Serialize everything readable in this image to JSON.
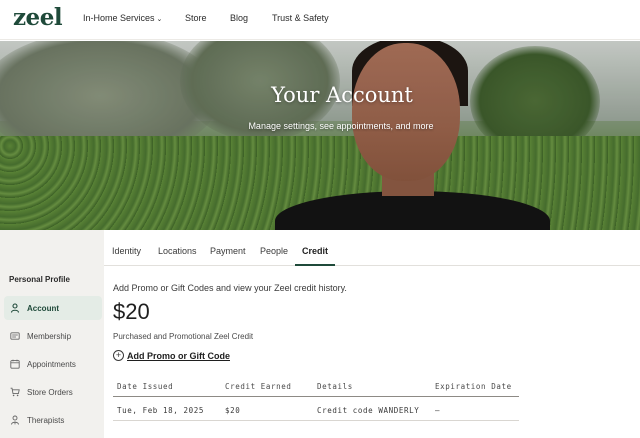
{
  "brand": {
    "logo_text": "zeel",
    "accent": "#1f4a3a"
  },
  "nav": {
    "items": [
      {
        "label": "In-Home Services",
        "has_dropdown": true
      },
      {
        "label": "Store"
      },
      {
        "label": "Blog"
      },
      {
        "label": "Trust & Safety"
      }
    ]
  },
  "hero": {
    "title": "Your Account",
    "subtitle": "Manage settings, see appointments, and more"
  },
  "tabs": {
    "items": [
      {
        "label": "Identity"
      },
      {
        "label": "Locations"
      },
      {
        "label": "Payment"
      },
      {
        "label": "People"
      },
      {
        "label": "Credit",
        "active": true
      }
    ]
  },
  "sidebar": {
    "heading": "Personal Profile",
    "items": [
      {
        "label": "Account",
        "icon": "user-icon",
        "active": true
      },
      {
        "label": "Membership",
        "icon": "membership-card-icon"
      },
      {
        "label": "Appointments",
        "icon": "calendar-icon"
      },
      {
        "label": "Store Orders",
        "icon": "shopping-cart-icon"
      },
      {
        "label": "Therapists",
        "icon": "therapist-icon"
      }
    ]
  },
  "credit": {
    "intro": "Add Promo or Gift Codes and view your Zeel credit history.",
    "balance": "$20",
    "balance_caption": "Purchased and Promotional Zeel Credit",
    "add_code_label": "Add Promo or Gift Code",
    "table": {
      "columns": [
        "Date Issued",
        "Credit Earned",
        "Details",
        "Expiration Date"
      ],
      "rows": [
        [
          "Tue, Feb 18, 2025",
          "$20",
          "Credit code WANDERLY",
          "—"
        ]
      ]
    }
  }
}
